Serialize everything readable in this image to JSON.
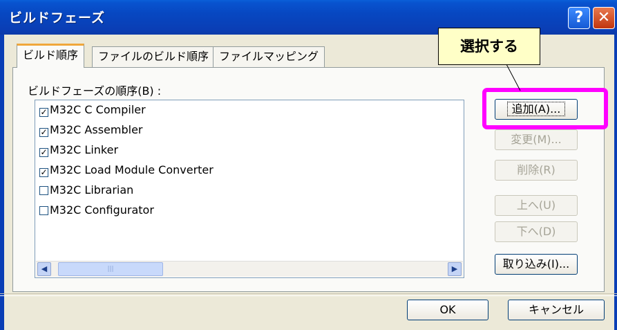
{
  "window": {
    "title": "ビルドフェーズ"
  },
  "tabs": [
    {
      "label": "ビルド順序",
      "active": true
    },
    {
      "label": "ファイルのビルド順序",
      "active": false
    },
    {
      "label": "ファイルマッピング",
      "active": false
    }
  ],
  "list_label": "ビルドフェーズの順序(B) :",
  "phases": [
    {
      "label": "M32C C Compiler",
      "checked": true
    },
    {
      "label": "M32C Assembler",
      "checked": true
    },
    {
      "label": "M32C Linker",
      "checked": true
    },
    {
      "label": "M32C Load Module Converter",
      "checked": true
    },
    {
      "label": "M32C Librarian",
      "checked": false
    },
    {
      "label": "M32C Configurator",
      "checked": false
    }
  ],
  "buttons": {
    "add": "追加(A)...",
    "modify": "変更(M)...",
    "delete": "削除(R)",
    "up": "上へ(U)",
    "down": "下へ(D)",
    "import": "取り込み(I)...",
    "ok": "OK",
    "cancel": "キャンセル"
  },
  "annotation": {
    "callout_text": "選択する",
    "highlight_color": "#ff00ff"
  },
  "icons": {
    "help": "help-icon",
    "close": "close-icon",
    "check": "✓"
  }
}
